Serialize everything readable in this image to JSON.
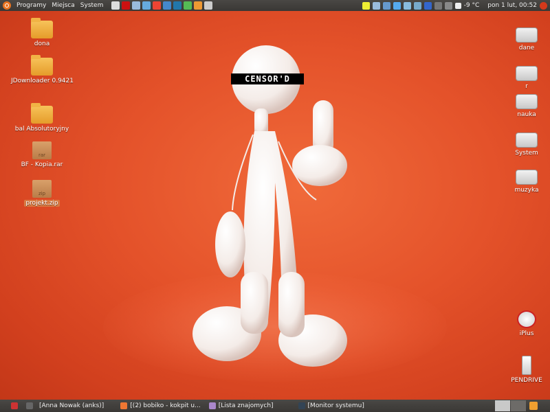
{
  "top_panel": {
    "menus": [
      "Programy",
      "Miejsca",
      "System"
    ],
    "tray": {
      "weather": "-9 °C",
      "clock": "pon   1 lut, 00:52"
    }
  },
  "desktop_icons_left": [
    {
      "label": "dona",
      "type": "folder"
    },
    {
      "label": "JDownloader 0.9421",
      "type": "folder"
    },
    {
      "label": "bal Absolutoryjny",
      "type": "folder"
    },
    {
      "label": "BF - Kopia.rar",
      "type": "archive",
      "badge": "rar"
    },
    {
      "label": "projekt.zip",
      "type": "archive",
      "badge": "zip",
      "selected": true
    }
  ],
  "desktop_icons_right": [
    {
      "label": "dane"
    },
    {
      "label": "r"
    },
    {
      "label": "nauka"
    },
    {
      "label": "System"
    },
    {
      "label": "muzyka"
    }
  ],
  "desktop_icons_right_bottom": [
    {
      "label": "iPlus"
    },
    {
      "label": "PENDRIVE"
    }
  ],
  "wallpaper": {
    "censor_text": "CENSOR'D"
  },
  "taskbar": {
    "tasks": [
      "[Anna Nowak (anks)]",
      "[(2) bobiko - kokpit u...",
      "[Lista znajomych]",
      "[Monitor systemu]"
    ]
  },
  "colors": {
    "background": "#e4522a",
    "panel": "#3f3d3a"
  }
}
